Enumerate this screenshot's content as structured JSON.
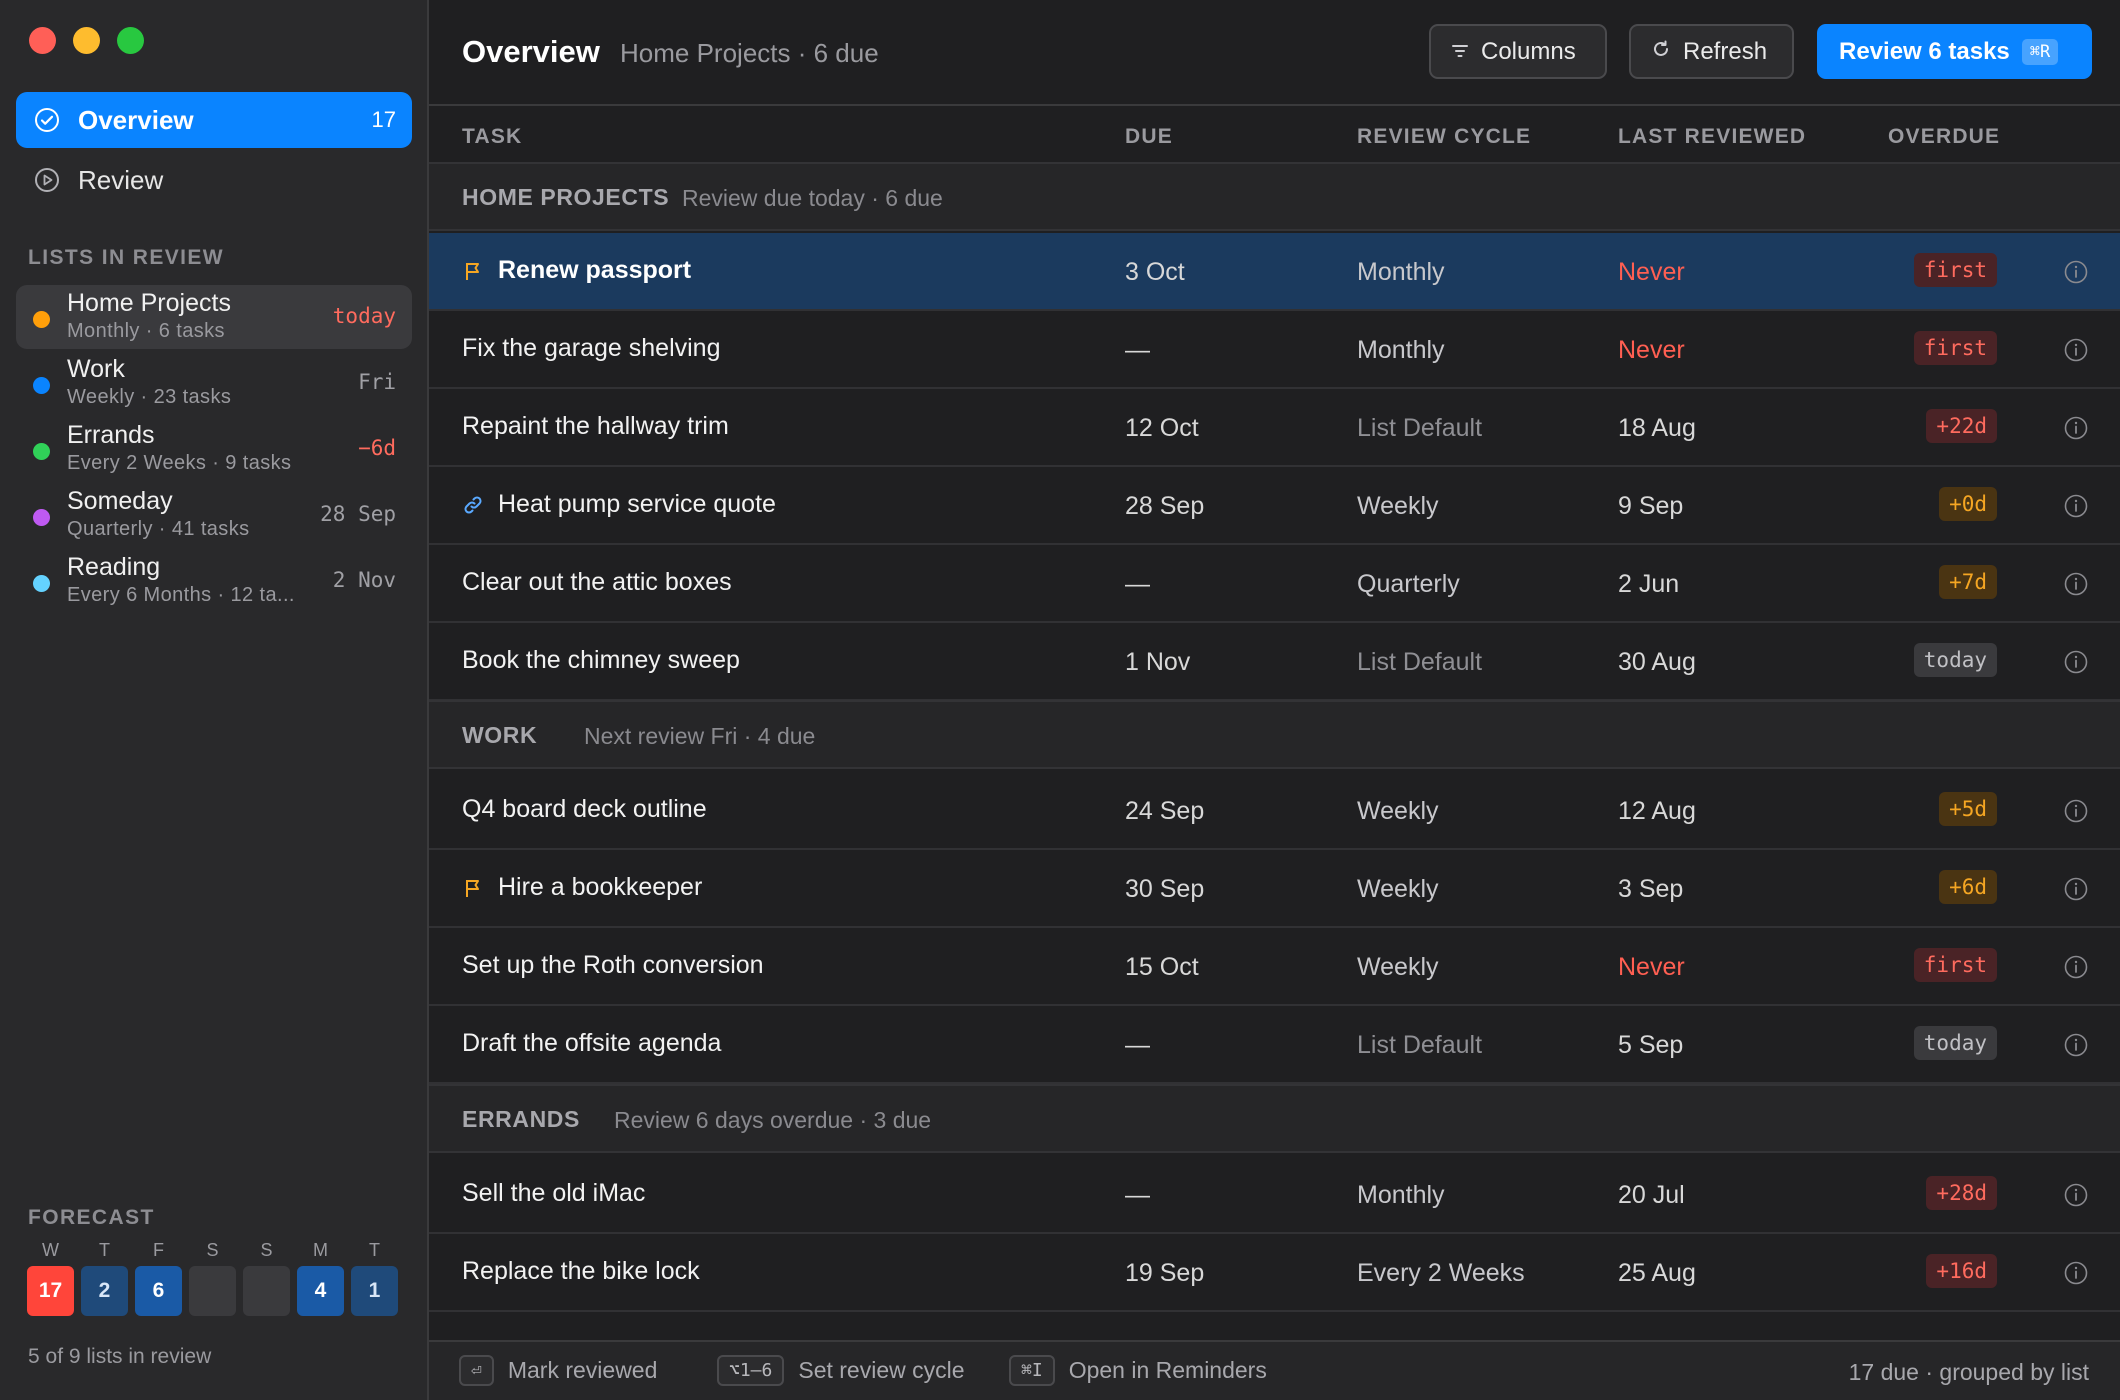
{
  "sidebar": {
    "nav": [
      {
        "label": "Overview",
        "count": "17",
        "icon": "check-circle-icon"
      },
      {
        "label": "Review",
        "count": "",
        "icon": "play-circle-icon"
      }
    ],
    "lists_heading": "LISTS IN REVIEW",
    "lists": [
      {
        "name": "Home Projects",
        "sub": "Monthly · 6 tasks",
        "due": "today",
        "color": "#ff9f0a"
      },
      {
        "name": "Work",
        "sub": "Weekly · 23 tasks",
        "due": "Fri",
        "color": "#0a84ff"
      },
      {
        "name": "Errands",
        "sub": "Every 2 Weeks · 9 tasks",
        "due": "−6d",
        "color": "#30d158"
      },
      {
        "name": "Someday",
        "sub": "Quarterly · 41 tasks",
        "due": "28 Sep",
        "color": "#bf5af2"
      },
      {
        "name": "Reading",
        "sub": "Every 6 Months · 12 ta...",
        "due": "2 Nov",
        "color": "#64d2ff"
      }
    ],
    "forecast_heading": "FORECAST",
    "forecast": [
      {
        "day": "W",
        "count": "17"
      },
      {
        "day": "T",
        "count": "2"
      },
      {
        "day": "F",
        "count": "6"
      },
      {
        "day": "S",
        "count": ""
      },
      {
        "day": "S",
        "count": ""
      },
      {
        "day": "M",
        "count": "4"
      },
      {
        "day": "T",
        "count": "1"
      }
    ],
    "footer": "5 of 9 lists in review"
  },
  "toolbar": {
    "title": "Overview",
    "subtitle": "Home Projects · 6 due",
    "columns_label": "Columns",
    "refresh_label": "Refresh",
    "review_label": "Review 6 tasks",
    "review_shortcut": "⌘R"
  },
  "columns": {
    "task": "TASK",
    "due": "DUE",
    "cycle": "REVIEW CYCLE",
    "last": "LAST REVIEWED",
    "overdue": "OVERDUE"
  },
  "groups": [
    {
      "name": "HOME PROJECTS",
      "meta": "Review due today · 6 due",
      "rows": [
        {
          "task": "Renew passport",
          "icon": "flag-icon",
          "due": "3 Oct",
          "cycle": "Monthly",
          "last": "Never",
          "overdue": "first"
        },
        {
          "task": "Fix the garage shelving",
          "icon": "",
          "due": "—",
          "cycle": "Monthly",
          "last": "Never",
          "overdue": "first"
        },
        {
          "task": "Repaint the hallway trim",
          "icon": "",
          "due": "12 Oct",
          "cycle": "List Default",
          "last": "18 Aug",
          "overdue": "+22d"
        },
        {
          "task": "Heat pump service quote",
          "icon": "link-icon",
          "due": "28 Sep",
          "cycle": "Weekly",
          "last": "9 Sep",
          "overdue": "+0d"
        },
        {
          "task": "Clear out the attic boxes",
          "icon": "",
          "due": "—",
          "cycle": "Quarterly",
          "last": "2 Jun",
          "overdue": "+7d"
        },
        {
          "task": "Book the chimney sweep",
          "icon": "",
          "due": "1 Nov",
          "cycle": "List Default",
          "last": "30 Aug",
          "overdue": "today"
        }
      ]
    },
    {
      "name": "WORK",
      "meta": "Next review Fri · 4 due",
      "rows": [
        {
          "task": "Q4 board deck outline",
          "icon": "",
          "due": "24 Sep",
          "cycle": "Weekly",
          "last": "12 Aug",
          "overdue": "+5d"
        },
        {
          "task": "Hire a bookkeeper",
          "icon": "flag-icon",
          "due": "30 Sep",
          "cycle": "Weekly",
          "last": "3 Sep",
          "overdue": "+6d"
        },
        {
          "task": "Set up the Roth conversion",
          "icon": "",
          "due": "15 Oct",
          "cycle": "Weekly",
          "last": "Never",
          "overdue": "first"
        },
        {
          "task": "Draft the offsite agenda",
          "icon": "",
          "due": "—",
          "cycle": "List Default",
          "last": "5 Sep",
          "overdue": "today"
        }
      ]
    },
    {
      "name": "ERRANDS",
      "meta": "Review 6 days overdue · 3 due",
      "rows": [
        {
          "task": "Sell the old iMac",
          "icon": "",
          "due": "—",
          "cycle": "Monthly",
          "last": "20 Jul",
          "overdue": "+28d"
        },
        {
          "task": "Replace the bike lock",
          "icon": "",
          "due": "19 Sep",
          "cycle": "Every 2 Weeks",
          "last": "25 Aug",
          "overdue": "+16d"
        }
      ]
    }
  ],
  "footer": {
    "mark_key": "⏎",
    "mark_label": "Mark reviewed",
    "cycle_key": "⌥1–6",
    "cycle_label": "Set review cycle",
    "open_key": "⌘I",
    "open_label": "Open in Reminders",
    "summary": "17 due · grouped by list"
  }
}
